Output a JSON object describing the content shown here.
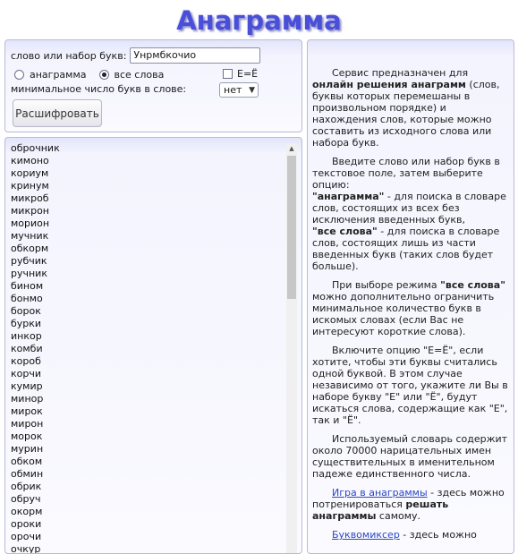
{
  "title": "Анаграмма",
  "form": {
    "word_label": "слово или набор букв:",
    "word_value": "Унрмбкочио",
    "mode_anagram_label": "анаграмма",
    "mode_all_label": "все слова",
    "selected_mode": "все слова",
    "ee_label": "Е=Ё",
    "ee_checked": false,
    "min_letters_label": "минимальное число букв в слове:",
    "min_letters_value": "нет",
    "submit_label": "Расшифровать"
  },
  "results": [
    "оброчник",
    "кимоно",
    "кориум",
    "кринум",
    "микроб",
    "микрон",
    "морион",
    "мучник",
    "обкорм",
    "рубчик",
    "ручник",
    "бином",
    "бонмо",
    "борок",
    "бурки",
    "инкор",
    "комби",
    "короб",
    "корчи",
    "кумир",
    "минор",
    "мирок",
    "мирон",
    "морок",
    "мурин",
    "обком",
    "обмин",
    "обрик",
    "обруч",
    "окорм",
    "ороки",
    "орочи",
    "очкур"
  ],
  "info": {
    "p1_pre": "Сервис предназначен для ",
    "p1_bold": "онлайн решения анаграмм",
    "p1_post": " (слов, буквы которых перемешаны в произвольном порядке) и нахождения слов, которые можно составить из исходного слова или набора букв.",
    "p2": "Введите слово или набор букв в текстовое поле, затем выберите опцию:",
    "opt1_bold": "\"анаграмма\"",
    "opt1_text": " - для поиска в словаре слов, состоящих из всех без исключения введенных букв,",
    "opt2_bold": "\"все слова\"",
    "opt2_text": " - для поиска в словаре слов, состоящих лишь из части введенных букв (таких слов будет больше).",
    "p3_pre": "При выборе режима ",
    "p3_bold": "\"все слова\"",
    "p3_post": " можно дополнительно ограничить минимальное количество букв в искомых словах (если Вас не интересуют короткие слова).",
    "p4": "Включите опцию \"Е=Ё\", если хотите, чтобы эти буквы считались одной буквой. В этом случае независимо от того, укажите ли Вы в наборе букву \"Е\" или \"Ё\", будут искаться слова, содержащие как \"Е\", так и \"Ё\".",
    "p5": "Используемый словарь содержит около 70000 нарицательных имен существительных в именительном падеже единственного числа.",
    "link1": "Игра в анаграммы",
    "link1_text": " - здесь можно потренироваться ",
    "link1_bold": "решать анаграммы",
    "link1_end": " самому.",
    "link2": "Буквомиксер",
    "link2_text": " - здесь можно"
  }
}
